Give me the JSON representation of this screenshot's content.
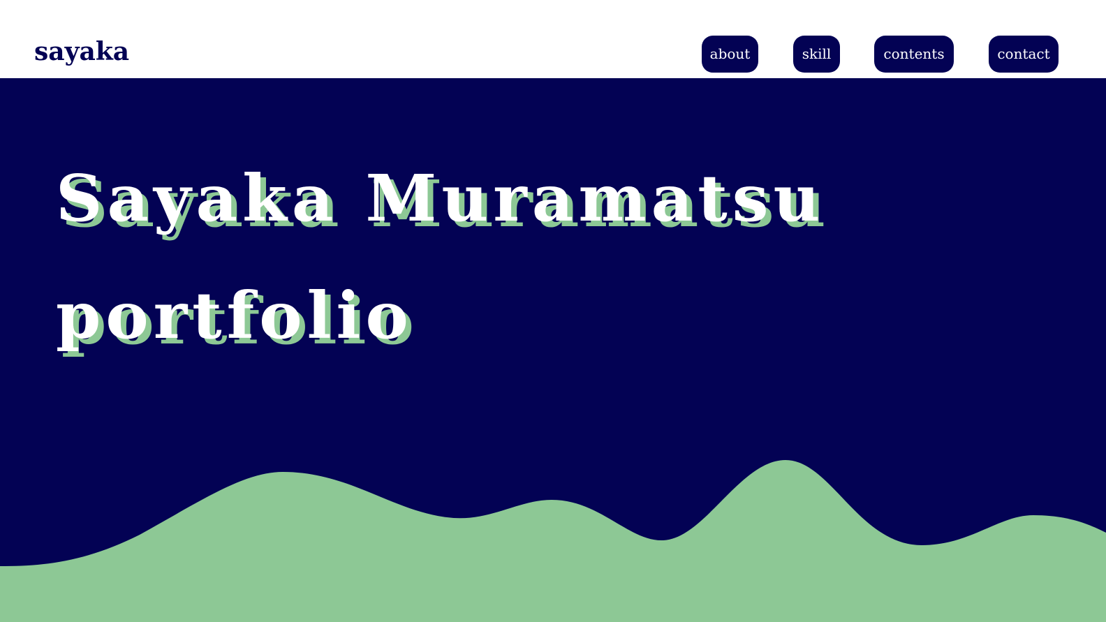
{
  "header": {
    "logo": "sayaka"
  },
  "nav": {
    "items": [
      {
        "label": "about"
      },
      {
        "label": "skill"
      },
      {
        "label": "contents"
      },
      {
        "label": "contact"
      }
    ]
  },
  "hero": {
    "title_line1": "Sayaka Muramatsu",
    "title_line2": "portfolio"
  },
  "colors": {
    "navy": "#030254",
    "green": "#8dc895",
    "white": "#ffffff"
  }
}
